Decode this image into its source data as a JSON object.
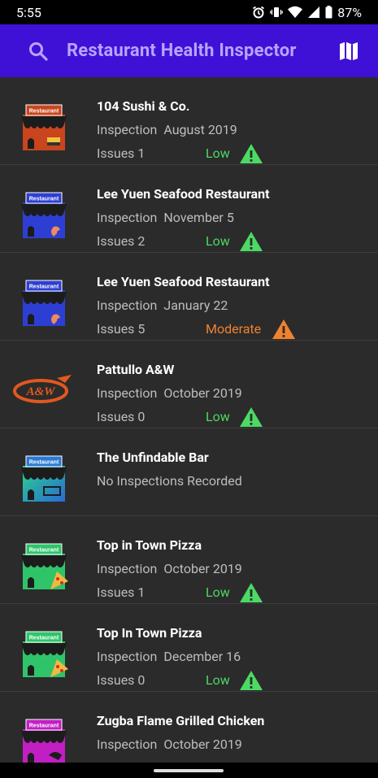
{
  "status_bar": {
    "time": "5:55",
    "battery": "87%"
  },
  "app_bar": {
    "title": "Restaurant Health Inspector",
    "search_icon": "search-icon",
    "map_icon": "map-icon",
    "color": "#3f10d6",
    "title_color": "#b8a4ff"
  },
  "restaurants": [
    {
      "name": "104 Sushi & Co.",
      "inspection_label": "Inspection",
      "inspection_date": "August 2019",
      "issues_label": "Issues",
      "issues": "1",
      "level": "Low",
      "level_color": "#4cd964",
      "icon": "restaurant-sushi-icon"
    },
    {
      "name": "Lee Yuen Seafood Restaurant",
      "inspection_label": "Inspection",
      "inspection_date": "November 5",
      "issues_label": "Issues",
      "issues": "2",
      "level": "Low",
      "level_color": "#4cd964",
      "icon": "restaurant-seafood-icon"
    },
    {
      "name": "Lee Yuen Seafood Restaurant",
      "inspection_label": "Inspection",
      "inspection_date": "January 22",
      "issues_label": "Issues",
      "issues": "5",
      "level": "Moderate",
      "level_color": "#f0822e",
      "icon": "restaurant-seafood-icon"
    },
    {
      "name": "Pattullo A&W",
      "inspection_label": "Inspection",
      "inspection_date": "October 2019",
      "issues_label": "Issues",
      "issues": "0",
      "level": "Low",
      "level_color": "#4cd964",
      "icon": "aw-logo-icon"
    },
    {
      "name": "The Unfindable Bar",
      "no_inspection": "No Inspections Recorded",
      "icon": "restaurant-generic-icon"
    },
    {
      "name": "Top in Town Pizza",
      "inspection_label": "Inspection",
      "inspection_date": "October 2019",
      "issues_label": "Issues",
      "issues": "1",
      "level": "Low",
      "level_color": "#4cd964",
      "icon": "restaurant-pizza-icon"
    },
    {
      "name": "Top In Town Pizza",
      "inspection_label": "Inspection",
      "inspection_date": "December 16",
      "issues_label": "Issues",
      "issues": "0",
      "level": "Low",
      "level_color": "#4cd964",
      "icon": "restaurant-pizza-icon"
    },
    {
      "name": "Zugba Flame Grilled Chicken",
      "inspection_label": "Inspection",
      "inspection_date": "October 2019",
      "icon": "restaurant-chicken-icon"
    }
  ],
  "shop_sign": "Restaurant"
}
